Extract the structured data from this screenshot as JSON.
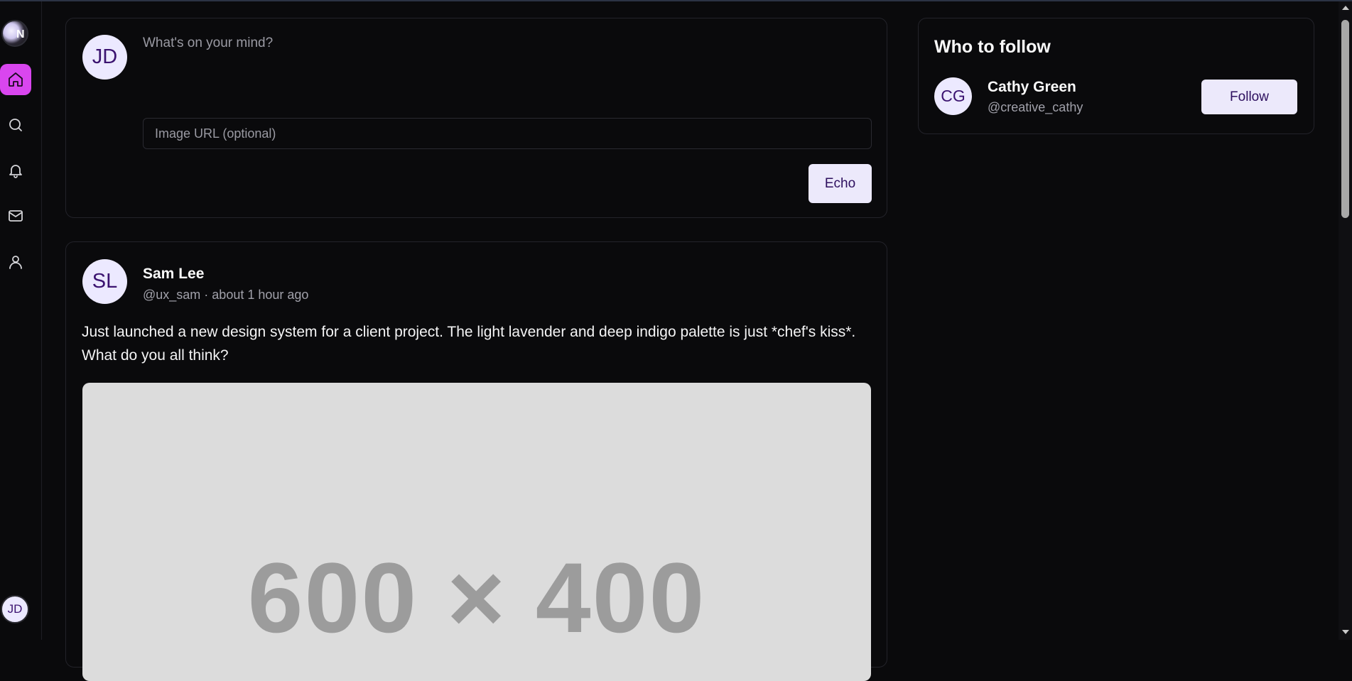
{
  "app": {
    "logo_letter": "N",
    "accent_color": "#d946ef"
  },
  "sidebar": {
    "items": [
      {
        "name": "home",
        "icon": "home-icon",
        "active": true
      },
      {
        "name": "search",
        "icon": "search-icon",
        "active": false
      },
      {
        "name": "notifications",
        "icon": "bell-icon",
        "active": false
      },
      {
        "name": "messages",
        "icon": "mail-icon",
        "active": false
      },
      {
        "name": "profile",
        "icon": "user-icon",
        "active": false
      }
    ],
    "user_initials": "JD"
  },
  "composer": {
    "avatar_initials": "JD",
    "placeholder": "What's on your mind?",
    "image_placeholder": "Image URL (optional)",
    "submit_label": "Echo"
  },
  "post": {
    "avatar_initials": "SL",
    "author": "Sam Lee",
    "meta": "@ux_sam · about 1 hour ago",
    "text": "Just launched a new design system for a client project. The light lavender and deep indigo palette is just *chef's kiss*. What do you all think?",
    "image_label": "600 × 400"
  },
  "who_to_follow": {
    "title": "Who to follow",
    "users": [
      {
        "initials": "CG",
        "name": "Cathy Green",
        "handle": "@creative_cathy",
        "button": "Follow"
      }
    ]
  }
}
